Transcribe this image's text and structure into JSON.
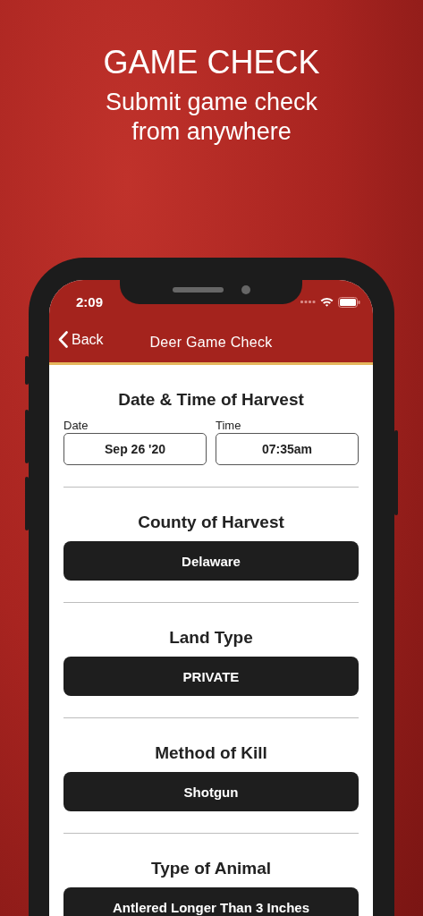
{
  "header": {
    "title": "GAME CHECK",
    "subtitle": "Submit game check from anywhere"
  },
  "status_bar": {
    "time": "2:09"
  },
  "nav": {
    "back": "Back",
    "title": "Deer Game Check"
  },
  "sections": [
    {
      "kind": "datetime",
      "heading": "Date & Time of Harvest",
      "fields": [
        {
          "label": "Date",
          "value": "Sep 26 '20"
        },
        {
          "label": "Time",
          "value": "07:35am"
        }
      ]
    },
    {
      "kind": "select",
      "heading": "County of Harvest",
      "value": "Delaware"
    },
    {
      "kind": "select",
      "heading": "Land Type",
      "value": "PRIVATE"
    },
    {
      "kind": "select",
      "heading": "Method of Kill",
      "value": "Shotgun"
    },
    {
      "kind": "select",
      "heading": "Type of Animal",
      "value": "Antlered Longer Than 3 Inches"
    }
  ]
}
